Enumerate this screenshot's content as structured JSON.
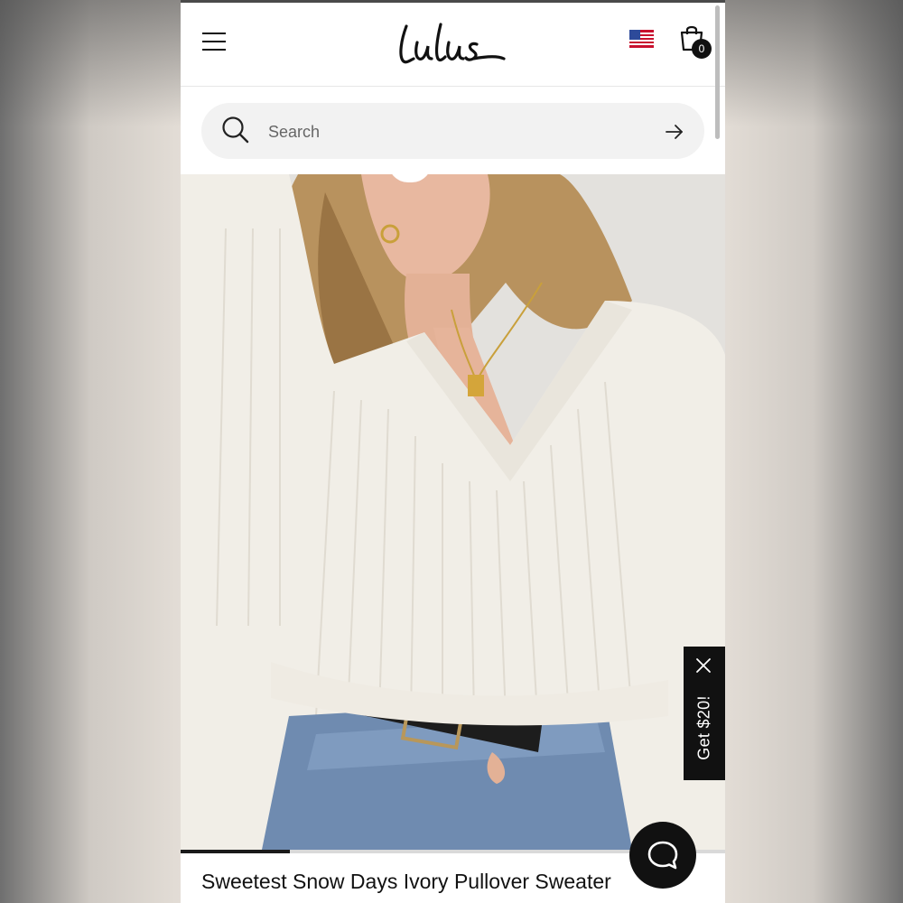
{
  "header": {
    "logo_text": "Lulus",
    "cart_count": "0",
    "menu_icon": "hamburger-icon",
    "flag_icon": "us-flag-icon",
    "cart_icon": "shopping-bag-icon"
  },
  "search": {
    "placeholder": "Search",
    "value": "",
    "submit_icon": "arrow-right-icon"
  },
  "product": {
    "title": "Sweetest Snow Days Ivory Pullover Sweater",
    "image_progress": 0.2
  },
  "promo": {
    "label": "Get $20!",
    "close_icon": "close-icon"
  },
  "chat": {
    "icon": "chat-bubble-icon"
  },
  "colors": {
    "accent": "#111111",
    "search_bg": "#f2f2f2",
    "promo_bg": "#111111"
  }
}
